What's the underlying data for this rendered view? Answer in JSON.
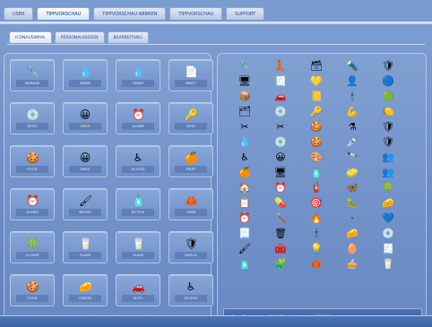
{
  "top_tabs": [
    {
      "label": "USER"
    },
    {
      "label": "TIPPVORSCHAU",
      "active": true
    },
    {
      "label": "TIPPVORSCHAU ABBREN"
    },
    {
      "label": "TIPPVORSCHAU"
    },
    {
      "label": "SUPPORT"
    }
  ],
  "sub_tabs": [
    {
      "label": "ICONAUSWAHL",
      "active": true
    },
    {
      "label": "PERSONALISIEREN"
    },
    {
      "label": "BEARBEITUNG"
    }
  ],
  "left_items": [
    {
      "icon": "🔧",
      "label": "MANAGE",
      "icon_name": "wrench-icon"
    },
    {
      "icon": "💧",
      "label": "DRAIN",
      "icon_name": "drop-icon"
    },
    {
      "icon": "💧",
      "label": "DRAIN",
      "icon_name": "drop-icon"
    },
    {
      "icon": "📄",
      "label": "DRAFT",
      "icon_name": "document-icon"
    },
    {
      "icon": "💿",
      "label": "DISKS",
      "icon_name": "disk-icon"
    },
    {
      "icon": "😀",
      "label": "SMILE",
      "icon_name": "smiley-icon",
      "highlight": true
    },
    {
      "icon": "⏰",
      "label": "ALARM",
      "icon_name": "clock-icon"
    },
    {
      "icon": "🔑",
      "label": "KEYS",
      "icon_name": "key-icon"
    },
    {
      "icon": "🍪",
      "label": "FOOD",
      "icon_name": "cookie-icon"
    },
    {
      "icon": "😀",
      "label": "SMILE",
      "icon_name": "smiley-icon"
    },
    {
      "icon": "♿",
      "label": "ACCESS",
      "icon_name": "accessibility-icon"
    },
    {
      "icon": "🍊",
      "label": "FRUIT",
      "icon_name": "orange-icon"
    },
    {
      "icon": "⏰",
      "label": "ALARM",
      "icon_name": "clock-icon"
    },
    {
      "icon": "🖌",
      "label": "BRUSH",
      "icon_name": "brush-icon"
    },
    {
      "icon": "🧴",
      "label": "BOTTLE",
      "icon_name": "bottle-icon"
    },
    {
      "icon": "🦀",
      "label": "CRAB",
      "icon_name": "crab-icon"
    },
    {
      "icon": "🍀",
      "label": "CLOVER",
      "icon_name": "clover-icon"
    },
    {
      "icon": "🥛",
      "label": "GLASS",
      "icon_name": "glass-icon"
    },
    {
      "icon": "🥛",
      "label": "GLASS",
      "icon_name": "glass-icon"
    },
    {
      "icon": "🛡",
      "label": "SHIELD",
      "icon_name": "shield-icon"
    },
    {
      "icon": "🍪",
      "label": "FOOD",
      "icon_name": "cookie-icon"
    },
    {
      "icon": "🧀",
      "label": "CHEESE",
      "icon_name": "cheese-icon"
    },
    {
      "icon": "🚗",
      "label": "AUTO",
      "icon_name": "car-icon"
    },
    {
      "icon": "♿",
      "label": "ACCESS",
      "icon_name": "accessibility-icon"
    }
  ],
  "right_items": [
    "🔧",
    "👢",
    "🗃",
    "🔦",
    "🛡",
    "🖥",
    "🧾",
    "💛",
    "👤",
    "🔵",
    "📦",
    "🚗",
    "📒",
    "🕯",
    "🟢",
    "🗂",
    "💿",
    "🔑",
    "💪",
    "🍋",
    "✂",
    "✂",
    "🍪",
    "⚗",
    "🛡",
    "💧",
    "💿",
    "🍪",
    "💉",
    "🛡",
    "♿",
    "😀",
    "🎨",
    "🔭",
    "👥",
    "🍊",
    "🖥",
    "🧴",
    "🧽",
    "👥",
    "🏠",
    "⏰",
    "🧯",
    "🦋",
    "🍀",
    "📋",
    "💊",
    "🎯",
    "🐛",
    "🧀",
    "⏰",
    "🔨",
    "🔥",
    "·",
    "💙",
    "📃",
    "🗑",
    "🕯",
    "🧀",
    "💿",
    "🖌",
    "🧰",
    "💡",
    "🥚",
    "🧾",
    "🧴",
    "🧩",
    "🦀",
    "🥧",
    "🥛"
  ],
  "status_text": "Zuvor Eingeschlossen (20 x 20 px, Hintergrund: 3AE8AEF)"
}
